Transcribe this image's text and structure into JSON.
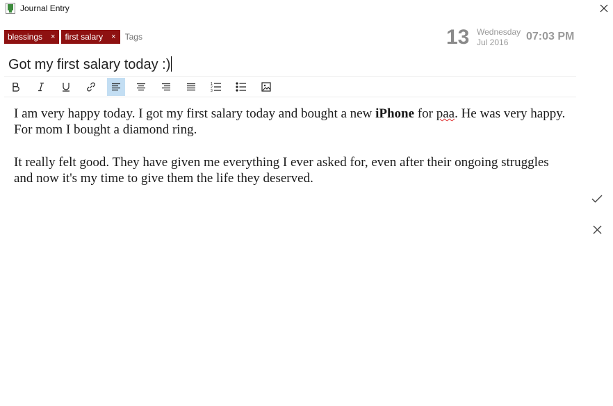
{
  "window": {
    "title": "Journal Entry"
  },
  "tags": {
    "items": [
      "blessings",
      "first salary"
    ],
    "placeholder": "Tags",
    "remove_glyph": "×"
  },
  "date": {
    "day": "13",
    "weekday": "Wednesday",
    "month_year": "Jul 2016",
    "time": "07:03 PM"
  },
  "entry": {
    "title": "Got my first salary today :)",
    "p1_before": "I am very happy today. I got my first salary today and bought a new ",
    "p1_bold": "iPhone",
    "p1_mid": " for ",
    "p1_misspelled": "paa",
    "p1_after": ". He was very happy. For mom I bought a diamond ring.",
    "p2": "It really felt good. They have given me everything I ever asked for, even after their ongoing struggles and now it's my time to give them the life they deserved."
  },
  "toolbar": {
    "buttons": [
      "bold",
      "italic",
      "underline",
      "link",
      "align-left",
      "align-center",
      "align-right",
      "align-justify",
      "numbered-list",
      "bulleted-list",
      "image"
    ],
    "active": "align-left"
  },
  "colors": {
    "tag_bg": "#8e1111",
    "active_bg": "#c3def3",
    "muted": "#9a9a9a"
  },
  "icons": [
    "journal-app-icon",
    "close-icon",
    "check-icon",
    "discard-icon"
  ]
}
